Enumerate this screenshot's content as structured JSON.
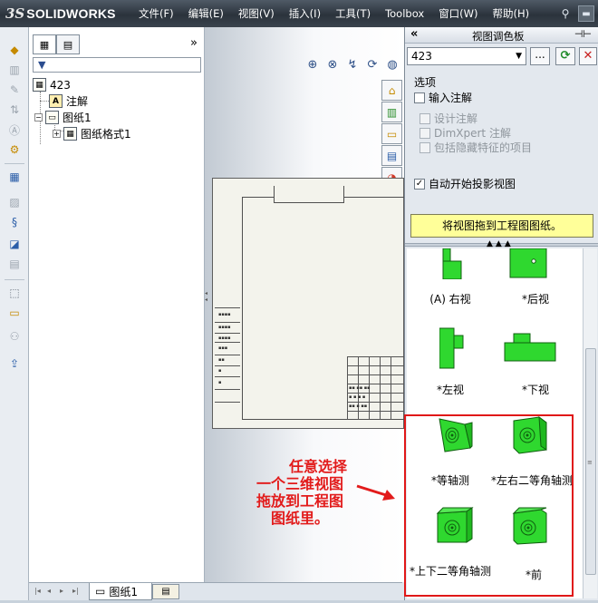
{
  "app": {
    "logo_prefix": "3S",
    "logo_text": "SOLIDWORKS"
  },
  "menu": [
    "文件(F)",
    "编辑(E)",
    "视图(V)",
    "插入(I)",
    "工具(T)",
    "Toolbox",
    "窗口(W)",
    "帮助(H)"
  ],
  "feature_tree": {
    "expand_symbol": "»",
    "root": "423",
    "items": [
      {
        "label": "注解",
        "icon": "annotation-icon",
        "glyph": "A"
      },
      {
        "label": "图纸1",
        "icon": "sheet-icon",
        "glyph": "▭"
      },
      {
        "label": "图纸格式1",
        "icon": "sheet-format-icon",
        "glyph": "▦"
      }
    ]
  },
  "bottom_tabs": {
    "sheet_tab": "图纸1"
  },
  "palette": {
    "title": "视图调色板",
    "collapse": "«",
    "model_select": "423",
    "browse_label": "...",
    "options_title": "选项",
    "checkboxes": [
      {
        "label": "输入注解",
        "checked": false,
        "enabled": true
      },
      {
        "label": "设计注解",
        "checked": false,
        "enabled": false
      },
      {
        "label": "DimXpert 注解",
        "checked": false,
        "enabled": false
      },
      {
        "label": "包括隐藏特征的项目",
        "checked": false,
        "enabled": false
      },
      {
        "label": "自动开始投影视图",
        "checked": true,
        "enabled": true
      }
    ],
    "drag_hint": "将视图拖到工程图图纸。",
    "views": [
      {
        "label": "(A) 右视"
      },
      {
        "label": "*后视"
      },
      {
        "label": "*左视"
      },
      {
        "label": "*下视"
      },
      {
        "label": "*等轴测"
      },
      {
        "label": "*左右二等角轴测"
      },
      {
        "label": "*上下二等角轴测"
      },
      {
        "label": "*前"
      }
    ]
  },
  "annotation": {
    "lines": [
      "任意选择",
      "一个三维视图",
      "拖放到工程图",
      "图纸里。"
    ],
    "color": "#e21b1b"
  },
  "colors": {
    "part_green": "#2fd82f",
    "highlight_red": "#e01818",
    "hint_yellow": "#ffff99"
  }
}
